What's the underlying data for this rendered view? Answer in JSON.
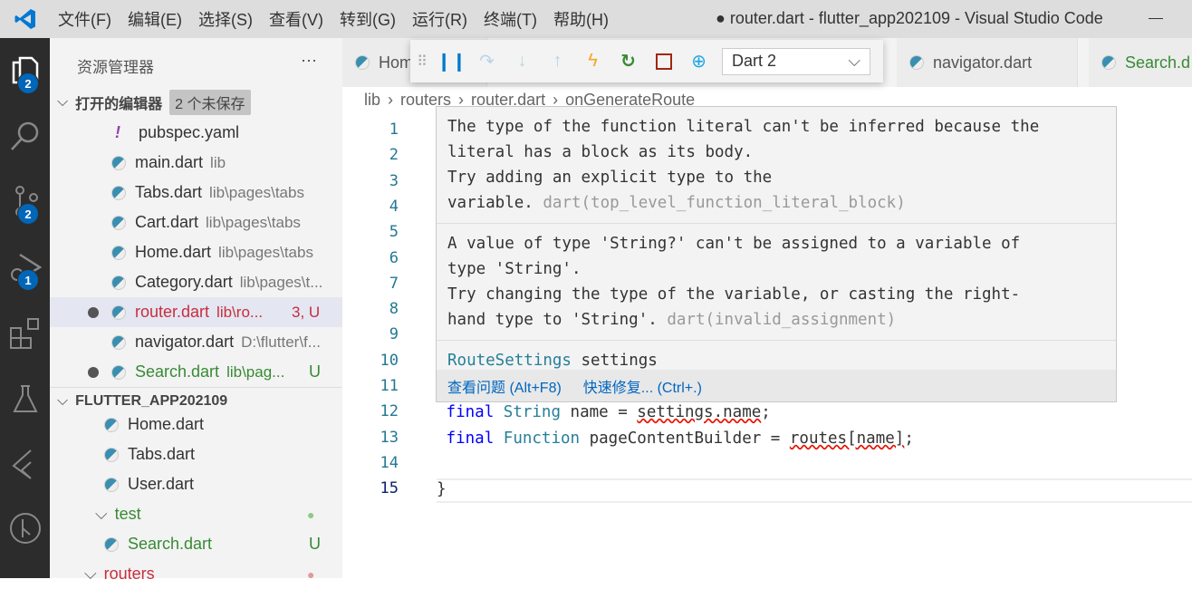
{
  "titlebar": {
    "menus": [
      "文件(F)",
      "编辑(E)",
      "选择(S)",
      "查看(V)",
      "转到(G)",
      "运行(R)",
      "终端(T)",
      "帮助(H)"
    ],
    "title": "● router.dart - flutter_app202109 - Visual Studio Code"
  },
  "activity": {
    "explorer_badge": "2",
    "scm_badge": "2",
    "debug_badge": "1"
  },
  "sidebar": {
    "title": "资源管理器",
    "more": "···",
    "open_editors": {
      "label": "打开的编辑器",
      "badge": "2 个未保存",
      "items": [
        {
          "name": "pubspec.yaml",
          "desc": "",
          "status": "",
          "icon": "yaml-icon"
        },
        {
          "name": "main.dart",
          "desc": "lib",
          "status": ""
        },
        {
          "name": "Tabs.dart",
          "desc": "lib\\pages\\tabs",
          "status": ""
        },
        {
          "name": "Cart.dart",
          "desc": "lib\\pages\\tabs",
          "status": ""
        },
        {
          "name": "Home.dart",
          "desc": "lib\\pages\\tabs",
          "status": ""
        },
        {
          "name": "Category.dart",
          "desc": "lib\\pages\\t...",
          "status": ""
        },
        {
          "name": "router.dart",
          "desc": "lib\\ro...",
          "status": "3, U"
        },
        {
          "name": "navigator.dart",
          "desc": "D:\\flutter\\f...",
          "status": ""
        },
        {
          "name": "Search.dart",
          "desc": "lib\\pag...",
          "status": "U"
        }
      ]
    },
    "project": {
      "label": "FLUTTER_APP202109",
      "items": [
        {
          "name": "Home.dart"
        },
        {
          "name": "Tabs.dart"
        },
        {
          "name": "User.dart"
        },
        {
          "name": "test",
          "status": "●"
        },
        {
          "name": "Search.dart",
          "status": "U"
        },
        {
          "name": "routers",
          "status": "●"
        }
      ]
    }
  },
  "tabs": [
    {
      "label": "Hom"
    },
    {
      "label": "navigator.dart"
    },
    {
      "label": "Search.d"
    }
  ],
  "debug_toolbar": {
    "target": "Dart 2",
    "colors": {
      "pause": "#007acc",
      "hot_reload": "#f5a623",
      "restart": "#388a34",
      "stop": "#a1260d"
    }
  },
  "breadcrumb": [
    "lib",
    "routers",
    "router.dart",
    "onGenerateRoute"
  ],
  "editor": {
    "line_numbers": [
      "1",
      "2",
      "3",
      "4",
      "5",
      "6",
      "7",
      "8",
      "9",
      "10",
      "11",
      "12",
      "13",
      "14",
      "15"
    ],
    "line12": {
      "kw": "final",
      "type": "String",
      "rest1": " name = ",
      "err": "settings.name",
      "rest2": ";"
    },
    "line13": {
      "kw": "final",
      "type": "Function",
      "rest1": " pageContentBuilder = ",
      "err": "routes[name]",
      "rest2": ";"
    },
    "line15": "}"
  },
  "hover": {
    "msg1": [
      "The type of the function literal can't be inferred because the",
      "literal has a block as its body.",
      "Try adding an explicit type to the"
    ],
    "msg1_last": "variable.",
    "msg1_code": "dart(top_level_function_literal_block)",
    "msg2": [
      "A value of type 'String?' can't be assigned to a variable of",
      "type 'String'.",
      "Try changing the type of the variable, or casting the right-"
    ],
    "msg2_last": "hand type to 'String'.",
    "msg2_code": "dart(invalid_assignment)",
    "sig_type": "RouteSettings",
    "sig_name": "settings",
    "view_problem": "查看问题 (Alt+F8)",
    "quick_fix": "快速修复... (Ctrl+.)"
  }
}
